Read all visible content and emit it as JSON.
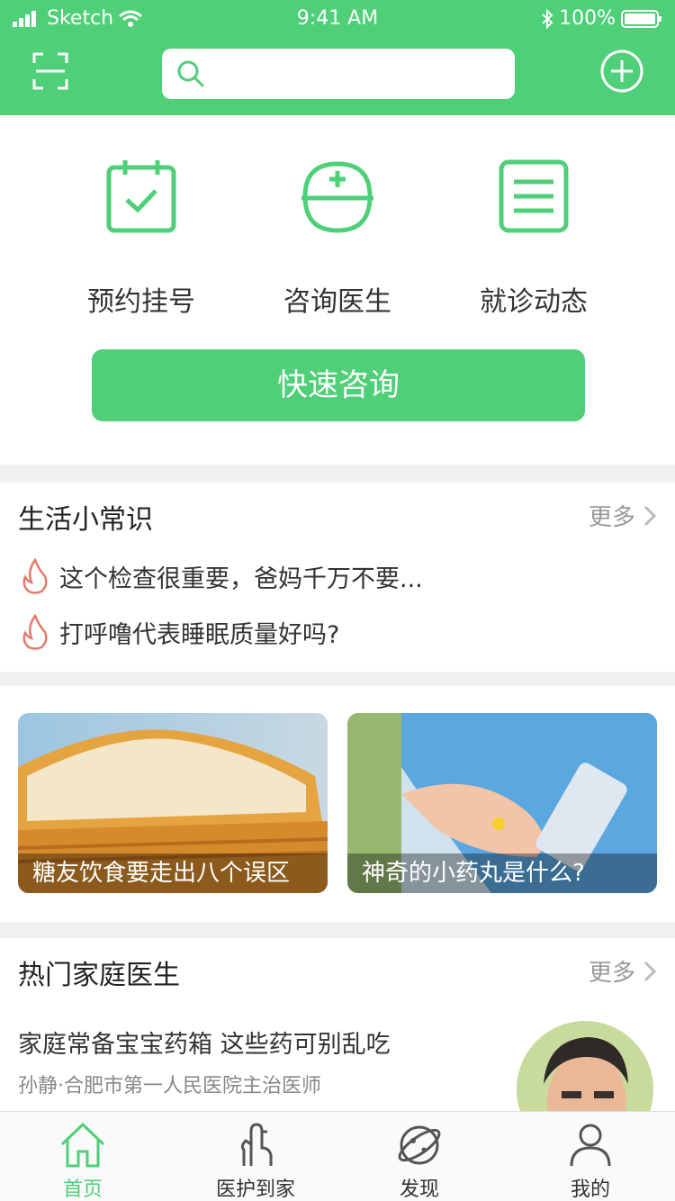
{
  "status_bar": {
    "carrier": "Sketch",
    "time": "9:41 AM",
    "battery": "100%"
  },
  "header": {
    "search": {
      "placeholder": ""
    }
  },
  "quick_actions": [
    {
      "label": "预约挂号",
      "icon": "calendar-check-icon"
    },
    {
      "label": "咨询医生",
      "icon": "doctor-cap-icon"
    },
    {
      "label": "就诊动态",
      "icon": "list-icon"
    }
  ],
  "quick_button": "快速咨询",
  "knowledge": {
    "title": "生活小常识",
    "more": "更多",
    "items": [
      "这个检查很重要，爸妈千万不要...",
      "打呼噜代表睡眠质量好吗?"
    ]
  },
  "cards": [
    {
      "caption": "糖友饮食要走出八个误区"
    },
    {
      "caption": "神奇的小药丸是什么?"
    }
  ],
  "doctor_section": {
    "title": "热门家庭医生",
    "more": "更多",
    "article_title": "家庭常备宝宝药箱 这些药可别乱吃",
    "article_sub": "孙静·合肥市第一人民医院主治医师"
  },
  "tabs": [
    {
      "label": "首页",
      "icon": "home-icon",
      "active": true
    },
    {
      "label": "医护到家",
      "icon": "hand-icon",
      "active": false
    },
    {
      "label": "发现",
      "icon": "planet-icon",
      "active": false
    },
    {
      "label": "我的",
      "icon": "user-icon",
      "active": false
    }
  ],
  "colors": {
    "primary": "#4fcf78",
    "fire": "#e07d6c"
  }
}
